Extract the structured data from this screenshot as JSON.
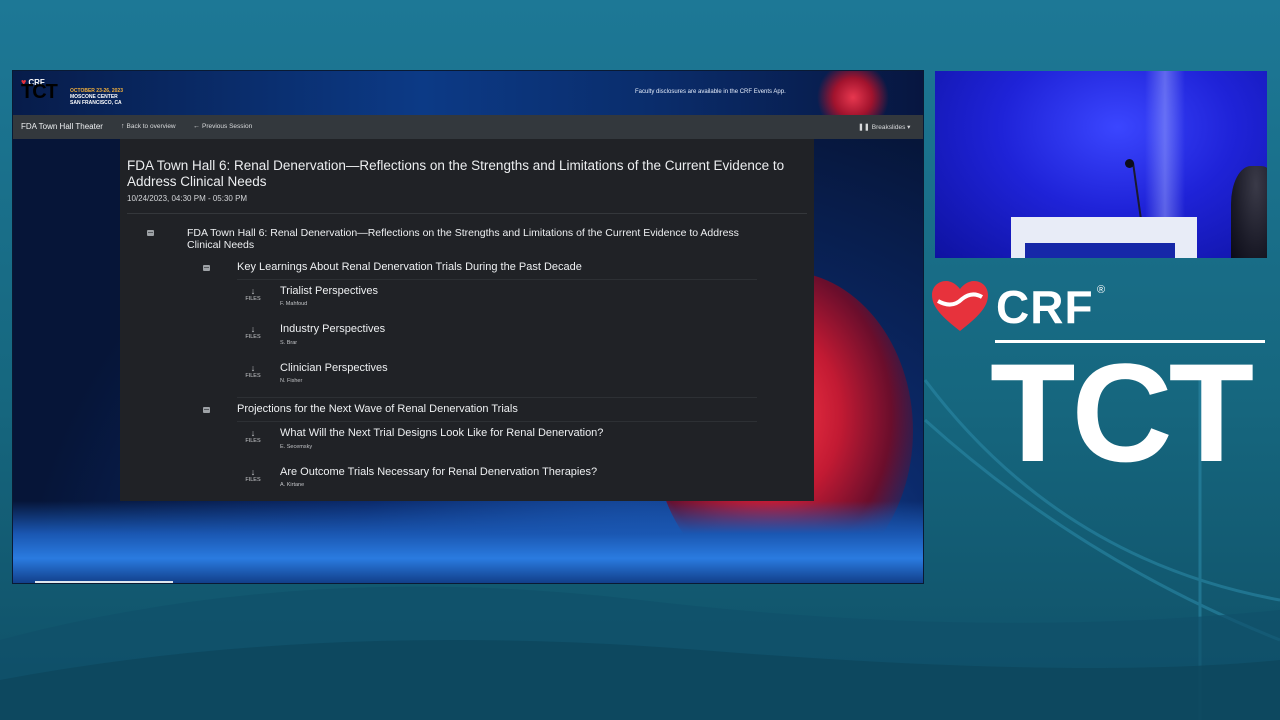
{
  "banner": {
    "crf": "CRF",
    "tct": "TCT",
    "dates": "OCTOBER 23-26, 2023",
    "venue": "MOSCONE CENTER",
    "city": "SAN FRANCISCO, CA",
    "disclosure": "Faculty disclosures are available in the CRF Events App."
  },
  "nav": {
    "brand": "FDA Town Hall Theater",
    "back": "Back to overview",
    "previous": "Previous Session",
    "breakslides": "Breakslides"
  },
  "session": {
    "title": "FDA Town Hall 6: Renal Denervation—Reflections on the Strengths and Limitations of the Current Evidence to Address Clinical Needs",
    "time": "10/24/2023, 04:30 PM - 05:30 PM",
    "agenda_title": "FDA Town Hall 6: Renal Denervation—Reflections on the Strengths and Limitations of the Current Evidence to Address Clinical Needs",
    "files_label": "FILES",
    "groups": [
      {
        "title": "Key Learnings About Renal Denervation Trials During the Past Decade",
        "talks": [
          {
            "title": "Trialist Perspectives",
            "speaker": "F. Mahfoud"
          },
          {
            "title": "Industry Perspectives",
            "speaker": "S. Brar"
          },
          {
            "title": "Clinician Perspectives",
            "speaker": "N. Fisher"
          }
        ]
      },
      {
        "title": "Projections for the Next Wave of Renal Denervation Trials",
        "talks": [
          {
            "title": "What Will the Next Trial Designs Look Like for Renal Denervation?",
            "speaker": "E. Secemsky"
          },
          {
            "title": "Are Outcome Trials Necessary for Renal Denervation Therapies?",
            "speaker": "A. Kirtane"
          }
        ]
      }
    ]
  },
  "branding": {
    "crf": "CRF",
    "reg": "®",
    "tct": "TCT"
  },
  "colors": {
    "accent_red": "#e7323c",
    "panel_bg": "#202226",
    "navbar_bg": "#33383d",
    "page_bg": "#1d7896"
  }
}
